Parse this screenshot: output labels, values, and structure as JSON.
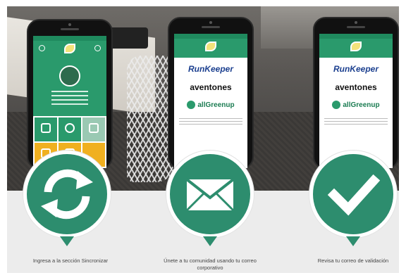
{
  "phones": [
    {
      "id": "phone-sync"
    },
    {
      "id": "phone-partners",
      "brands": [
        "RunKeeper",
        "aventones",
        "allGreenup"
      ]
    },
    {
      "id": "phone-verify",
      "brands": [
        "RunKeeper",
        "aventones",
        "allGreenup"
      ]
    }
  ],
  "steps": [
    {
      "icon": "sync-icon",
      "caption": "Ingresa a la sección Sincronizar"
    },
    {
      "icon": "envelope-icon",
      "caption": "Únete a tu comunidad usando tu correo corporativo"
    },
    {
      "icon": "checkmark-icon",
      "caption": "Revisa tu correo de validación"
    }
  ],
  "colors": {
    "accent": "#2d8d6e",
    "app_bar": "#2a9a6c",
    "tile_yellow": "#f0b020"
  }
}
